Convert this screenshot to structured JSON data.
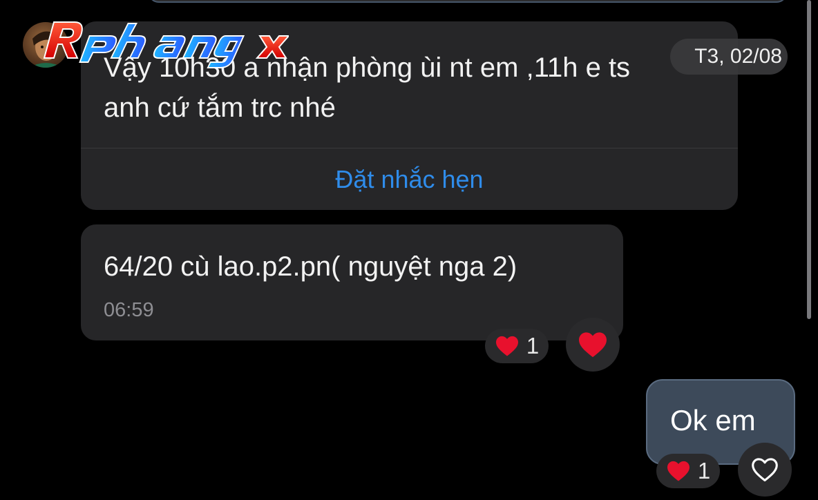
{
  "chat": {
    "messages": [
      {
        "text_line1": "Vậy 10h30 a nhận phòng ùi nt em ,11h e ts",
        "text_line2": "anh cứ tắm trc nhé",
        "action_label": "Đặt nhắc hẹn"
      },
      {
        "text": "64/20 cù lao.p2.pn( nguyệt nga 2)",
        "time": "06:59",
        "reaction_count": "1"
      },
      {
        "text": "Ok em",
        "reaction_count": "1"
      }
    ],
    "date_label": "T3, 02/08"
  },
  "watermark": {
    "text": "Rphangx"
  },
  "colors": {
    "background": "#000000",
    "incoming_bubble": "#262628",
    "outgoing_bubble": "#3d4a5a",
    "link_blue": "#2f8cea",
    "heart_red": "#e8112d"
  },
  "icons": {
    "reaction": "heart-icon",
    "react_outline": "heart-outline-icon"
  }
}
